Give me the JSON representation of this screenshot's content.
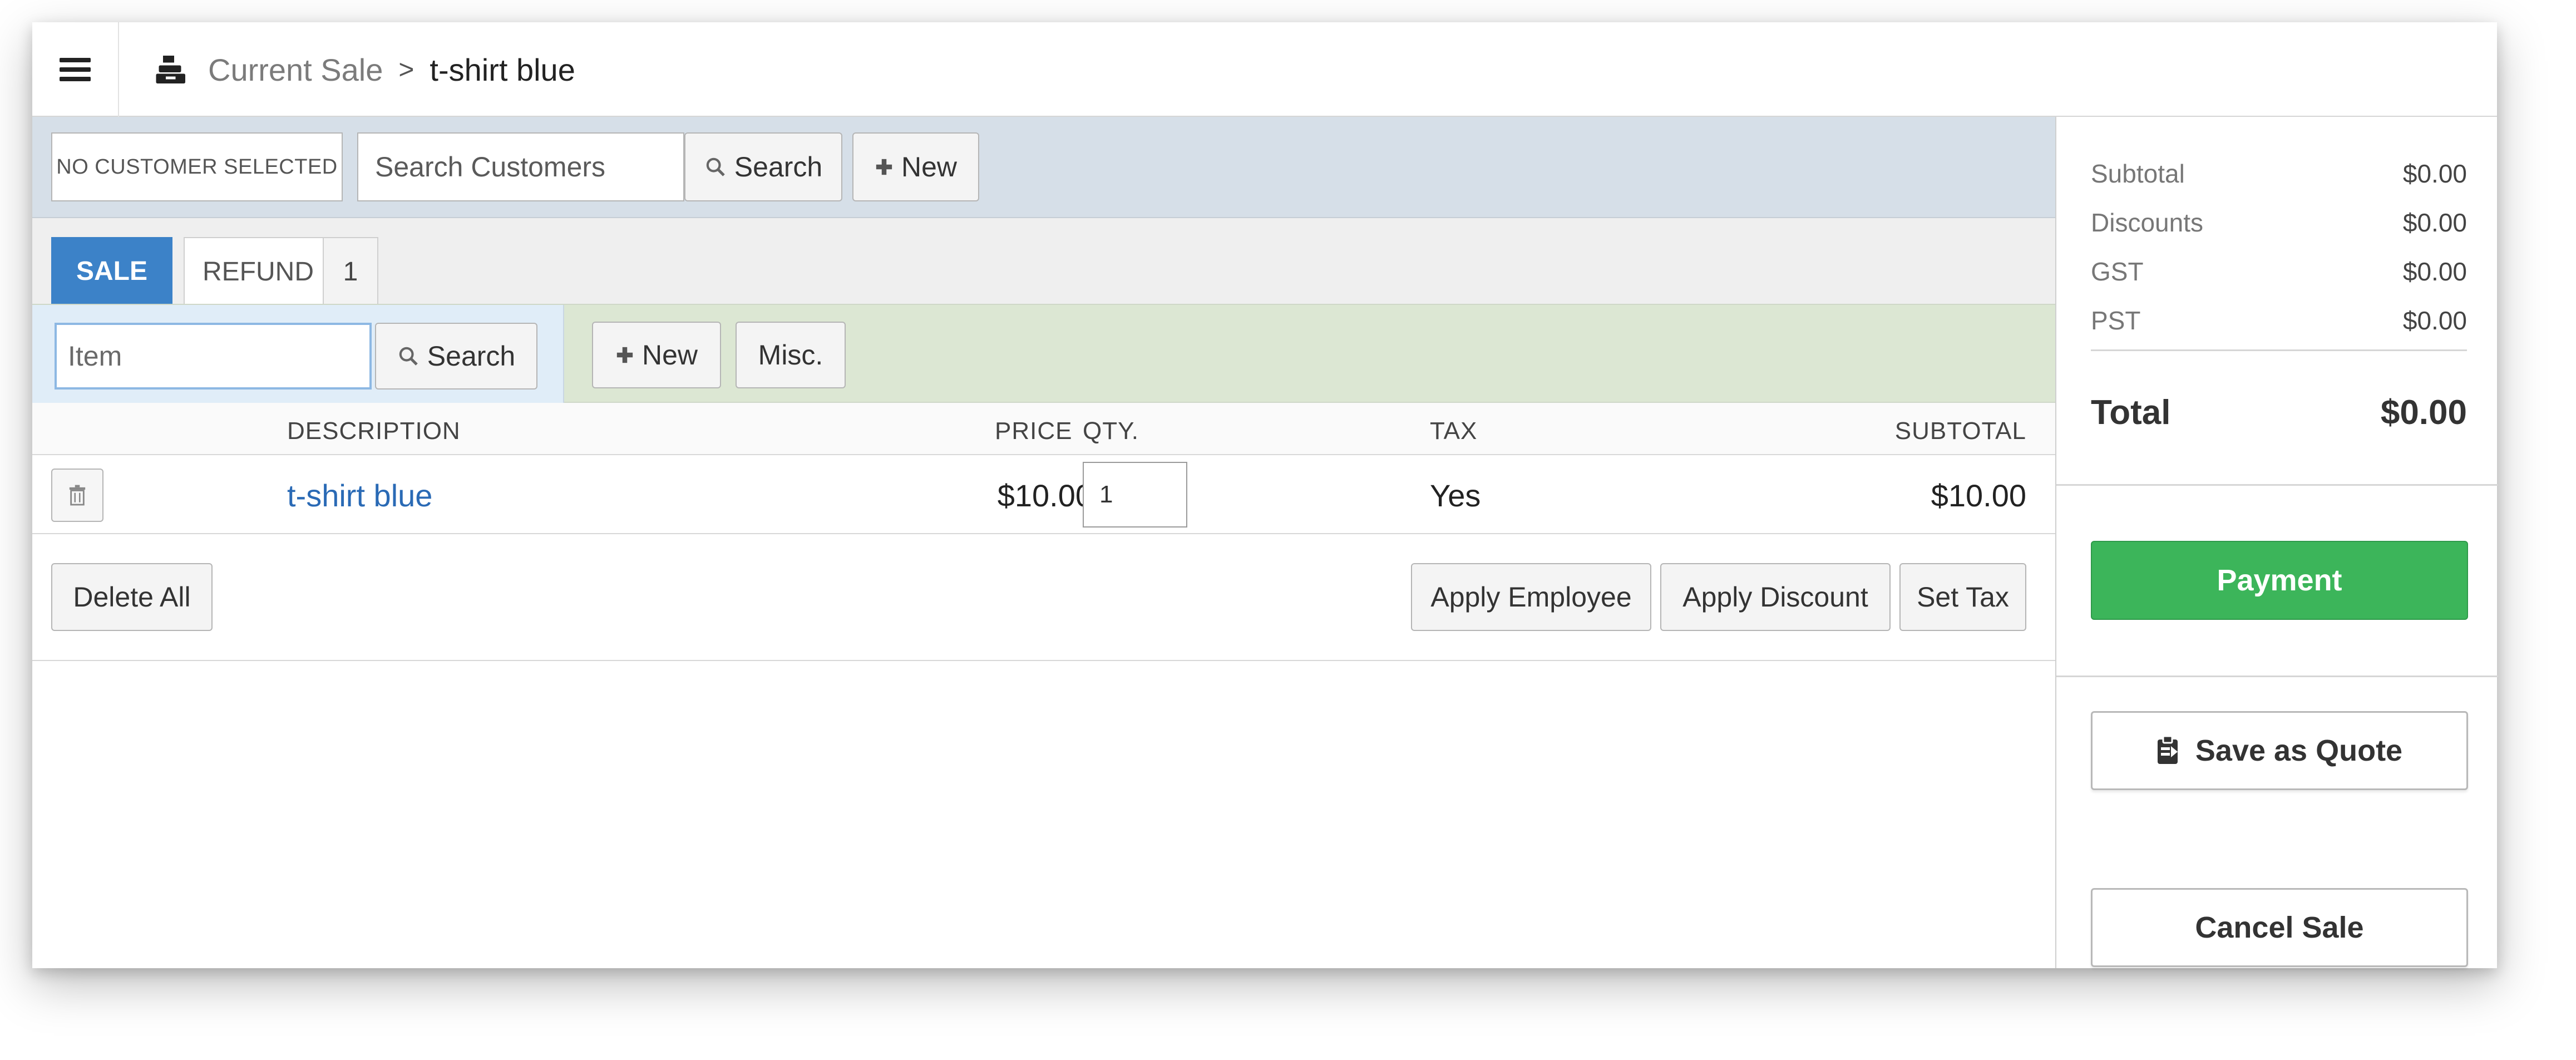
{
  "breadcrumb": {
    "current": "Current Sale",
    "separator": ">",
    "leaf": "t-shirt blue"
  },
  "customer": {
    "no_customer": "NO CUSTOMER SELECTED",
    "search_placeholder": "Search Customers",
    "search_label": "Search",
    "new_label": "New"
  },
  "tabs": {
    "sale": "SALE",
    "refund": "REFUND",
    "refund_count": "1"
  },
  "item_bar": {
    "item_placeholder": "Item",
    "search_label": "Search",
    "new_label": "New",
    "misc_label": "Misc."
  },
  "table": {
    "headers": {
      "description": "DESCRIPTION",
      "price": "PRICE",
      "qty": "QTY.",
      "tax": "TAX",
      "subtotal": "SUBTOTAL"
    },
    "rows": [
      {
        "description": "t-shirt blue",
        "price": "$10.00",
        "qty": "1",
        "tax": "Yes",
        "subtotal": "$10.00"
      }
    ]
  },
  "actions": {
    "delete_all": "Delete All",
    "apply_employee": "Apply Employee",
    "apply_discount": "Apply Discount",
    "set_tax": "Set Tax"
  },
  "summary": {
    "lines": [
      {
        "label": "Subtotal",
        "value": "$0.00"
      },
      {
        "label": "Discounts",
        "value": "$0.00"
      },
      {
        "label": "GST",
        "value": "$0.00"
      },
      {
        "label": "PST",
        "value": "$0.00"
      }
    ],
    "total_label": "Total",
    "total_value": "$0.00",
    "payment": "Payment",
    "save_quote": "Save as Quote",
    "cancel_sale": "Cancel Sale"
  },
  "colors": {
    "sale_tab": "#3c82c8",
    "payment": "#3cb55a",
    "link": "#2a6ab5",
    "customer_bar": "#d6dfe8",
    "item_bar": "#dce7d3"
  },
  "icons": [
    "menu-icon",
    "register-icon",
    "search-icon",
    "plus-icon",
    "trash-icon",
    "clipboard-icon"
  ]
}
